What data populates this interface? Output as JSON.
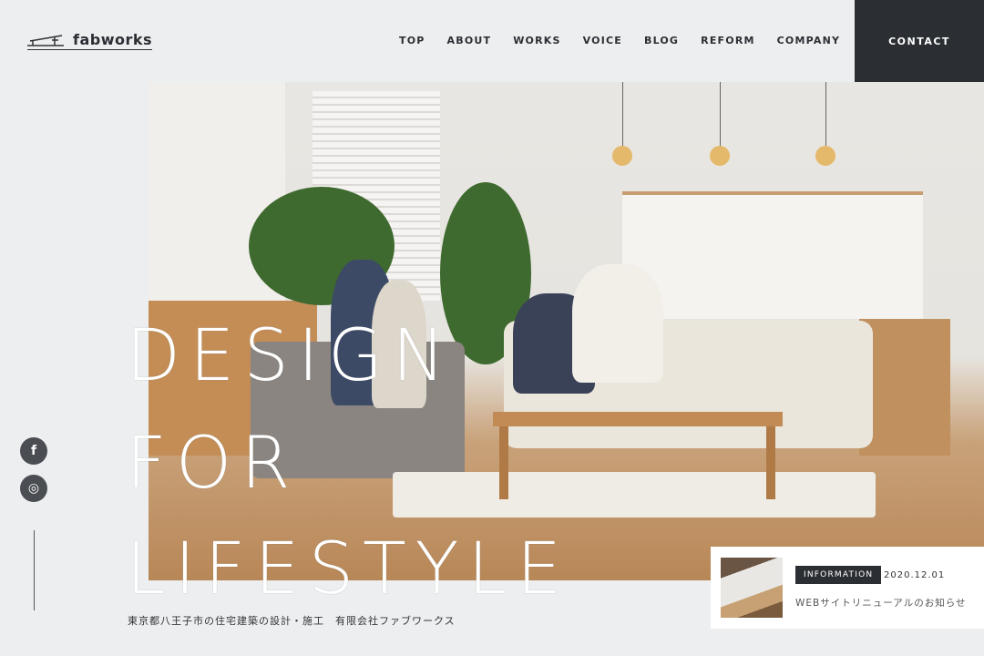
{
  "header": {
    "logo_text": "fabworks",
    "nav": [
      "TOP",
      "ABOUT",
      "WORKS",
      "VOICE",
      "BLOG",
      "REFORM",
      "COMPANY"
    ],
    "contact_label": "CONTACT"
  },
  "hero": {
    "headline": [
      "DESIGN",
      "FOR",
      "LIFESTYLE"
    ],
    "tagline": "東京都八王子市の住宅建築の設計・施工　有限会社ファブワークス"
  },
  "social": [
    {
      "icon": "facebook-icon",
      "glyph": "f"
    },
    {
      "icon": "instagram-icon",
      "glyph": "◎"
    }
  ],
  "news": {
    "badge": "INFORMATION",
    "date": "2020.12.01",
    "title": "WEBサイトリニューアルのお知らせ"
  },
  "colors": {
    "dark": "#2b2e33",
    "background": "#eceef0"
  }
}
